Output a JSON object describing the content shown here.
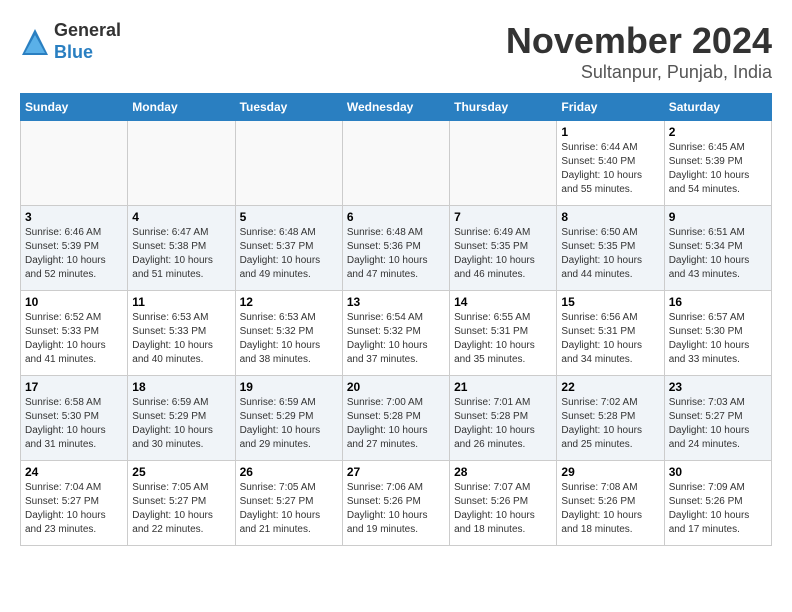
{
  "logo": {
    "general": "General",
    "blue": "Blue"
  },
  "header": {
    "month": "November 2024",
    "location": "Sultanpur, Punjab, India"
  },
  "weekdays": [
    "Sunday",
    "Monday",
    "Tuesday",
    "Wednesday",
    "Thursday",
    "Friday",
    "Saturday"
  ],
  "weeks": [
    [
      {
        "day": "",
        "info": ""
      },
      {
        "day": "",
        "info": ""
      },
      {
        "day": "",
        "info": ""
      },
      {
        "day": "",
        "info": ""
      },
      {
        "day": "",
        "info": ""
      },
      {
        "day": "1",
        "info": "Sunrise: 6:44 AM\nSunset: 5:40 PM\nDaylight: 10 hours and 55 minutes."
      },
      {
        "day": "2",
        "info": "Sunrise: 6:45 AM\nSunset: 5:39 PM\nDaylight: 10 hours and 54 minutes."
      }
    ],
    [
      {
        "day": "3",
        "info": "Sunrise: 6:46 AM\nSunset: 5:39 PM\nDaylight: 10 hours and 52 minutes."
      },
      {
        "day": "4",
        "info": "Sunrise: 6:47 AM\nSunset: 5:38 PM\nDaylight: 10 hours and 51 minutes."
      },
      {
        "day": "5",
        "info": "Sunrise: 6:48 AM\nSunset: 5:37 PM\nDaylight: 10 hours and 49 minutes."
      },
      {
        "day": "6",
        "info": "Sunrise: 6:48 AM\nSunset: 5:36 PM\nDaylight: 10 hours and 47 minutes."
      },
      {
        "day": "7",
        "info": "Sunrise: 6:49 AM\nSunset: 5:35 PM\nDaylight: 10 hours and 46 minutes."
      },
      {
        "day": "8",
        "info": "Sunrise: 6:50 AM\nSunset: 5:35 PM\nDaylight: 10 hours and 44 minutes."
      },
      {
        "day": "9",
        "info": "Sunrise: 6:51 AM\nSunset: 5:34 PM\nDaylight: 10 hours and 43 minutes."
      }
    ],
    [
      {
        "day": "10",
        "info": "Sunrise: 6:52 AM\nSunset: 5:33 PM\nDaylight: 10 hours and 41 minutes."
      },
      {
        "day": "11",
        "info": "Sunrise: 6:53 AM\nSunset: 5:33 PM\nDaylight: 10 hours and 40 minutes."
      },
      {
        "day": "12",
        "info": "Sunrise: 6:53 AM\nSunset: 5:32 PM\nDaylight: 10 hours and 38 minutes."
      },
      {
        "day": "13",
        "info": "Sunrise: 6:54 AM\nSunset: 5:32 PM\nDaylight: 10 hours and 37 minutes."
      },
      {
        "day": "14",
        "info": "Sunrise: 6:55 AM\nSunset: 5:31 PM\nDaylight: 10 hours and 35 minutes."
      },
      {
        "day": "15",
        "info": "Sunrise: 6:56 AM\nSunset: 5:31 PM\nDaylight: 10 hours and 34 minutes."
      },
      {
        "day": "16",
        "info": "Sunrise: 6:57 AM\nSunset: 5:30 PM\nDaylight: 10 hours and 33 minutes."
      }
    ],
    [
      {
        "day": "17",
        "info": "Sunrise: 6:58 AM\nSunset: 5:30 PM\nDaylight: 10 hours and 31 minutes."
      },
      {
        "day": "18",
        "info": "Sunrise: 6:59 AM\nSunset: 5:29 PM\nDaylight: 10 hours and 30 minutes."
      },
      {
        "day": "19",
        "info": "Sunrise: 6:59 AM\nSunset: 5:29 PM\nDaylight: 10 hours and 29 minutes."
      },
      {
        "day": "20",
        "info": "Sunrise: 7:00 AM\nSunset: 5:28 PM\nDaylight: 10 hours and 27 minutes."
      },
      {
        "day": "21",
        "info": "Sunrise: 7:01 AM\nSunset: 5:28 PM\nDaylight: 10 hours and 26 minutes."
      },
      {
        "day": "22",
        "info": "Sunrise: 7:02 AM\nSunset: 5:28 PM\nDaylight: 10 hours and 25 minutes."
      },
      {
        "day": "23",
        "info": "Sunrise: 7:03 AM\nSunset: 5:27 PM\nDaylight: 10 hours and 24 minutes."
      }
    ],
    [
      {
        "day": "24",
        "info": "Sunrise: 7:04 AM\nSunset: 5:27 PM\nDaylight: 10 hours and 23 minutes."
      },
      {
        "day": "25",
        "info": "Sunrise: 7:05 AM\nSunset: 5:27 PM\nDaylight: 10 hours and 22 minutes."
      },
      {
        "day": "26",
        "info": "Sunrise: 7:05 AM\nSunset: 5:27 PM\nDaylight: 10 hours and 21 minutes."
      },
      {
        "day": "27",
        "info": "Sunrise: 7:06 AM\nSunset: 5:26 PM\nDaylight: 10 hours and 19 minutes."
      },
      {
        "day": "28",
        "info": "Sunrise: 7:07 AM\nSunset: 5:26 PM\nDaylight: 10 hours and 18 minutes."
      },
      {
        "day": "29",
        "info": "Sunrise: 7:08 AM\nSunset: 5:26 PM\nDaylight: 10 hours and 18 minutes."
      },
      {
        "day": "30",
        "info": "Sunrise: 7:09 AM\nSunset: 5:26 PM\nDaylight: 10 hours and 17 minutes."
      }
    ]
  ]
}
